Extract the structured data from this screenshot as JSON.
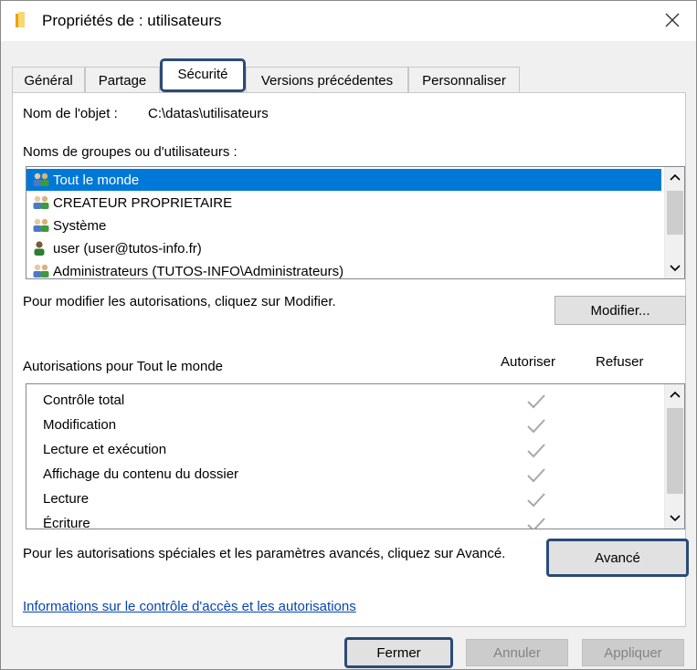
{
  "window": {
    "title": "Propriétés de : utilisateurs",
    "close_glyph": "✕"
  },
  "tabs": [
    {
      "label": "Général"
    },
    {
      "label": "Partage"
    },
    {
      "label": "Sécurité",
      "active": true
    },
    {
      "label": "Versions précédentes"
    },
    {
      "label": "Personnaliser"
    }
  ],
  "object": {
    "name_label": "Nom de l'objet :",
    "name_value": "C:\\datas\\utilisateurs"
  },
  "groups": {
    "heading": "Noms de groupes ou d'utilisateurs :",
    "items": [
      {
        "label": "Tout le monde",
        "icon": "group-icon",
        "selected": true
      },
      {
        "label": "CREATEUR PROPRIETAIRE",
        "icon": "group-icon"
      },
      {
        "label": "Système",
        "icon": "group-icon"
      },
      {
        "label": "user (user@tutos-info.fr)",
        "icon": "user-icon"
      },
      {
        "label": "Administrateurs (TUTOS-INFO\\Administrateurs)",
        "icon": "group-icon"
      }
    ],
    "modify_hint": "Pour modifier les autorisations, cliquez sur Modifier.",
    "modify_button": "Modifier..."
  },
  "permissions": {
    "heading": "Autorisations pour Tout le monde",
    "allow_header": "Autoriser",
    "deny_header": "Refuser",
    "rows": [
      {
        "name": "Contrôle total",
        "allow": true,
        "deny": false
      },
      {
        "name": "Modification",
        "allow": true,
        "deny": false
      },
      {
        "name": "Lecture et exécution",
        "allow": true,
        "deny": false
      },
      {
        "name": "Affichage du contenu du dossier",
        "allow": true,
        "deny": false
      },
      {
        "name": "Lecture",
        "allow": true,
        "deny": false
      },
      {
        "name": "Écriture",
        "allow": true,
        "deny": false
      }
    ]
  },
  "advanced": {
    "hint": "Pour les autorisations spéciales et les paramètres avancés, cliquez sur Avancé.",
    "button": "Avancé"
  },
  "help_link": "Informations sur le contrôle d'accès et les autorisations",
  "footer": {
    "close": "Fermer",
    "cancel": "Annuler",
    "apply": "Appliquer"
  },
  "colors": {
    "selection": "#0078d7",
    "highlight_border": "#2b4b78",
    "link": "#0645ad"
  }
}
